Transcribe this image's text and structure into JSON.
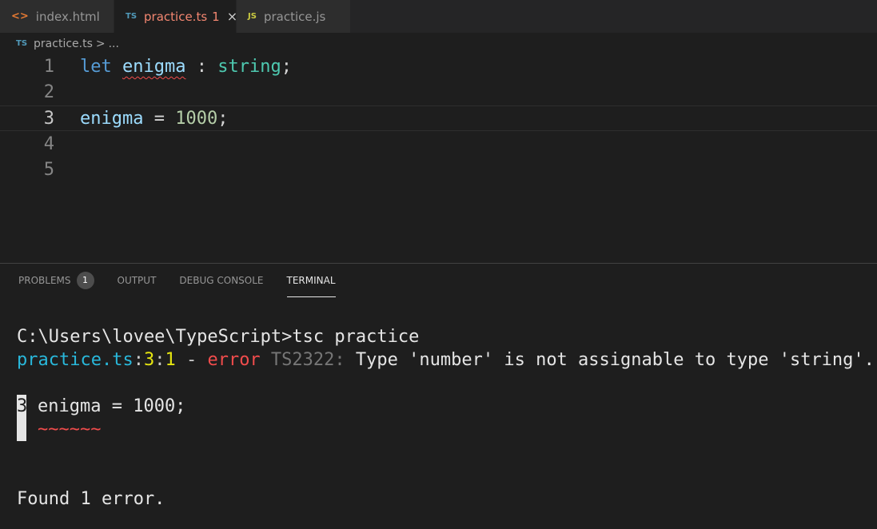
{
  "tabs": [
    {
      "icon": "<>",
      "label": "index.html"
    },
    {
      "icon": "TS",
      "label": "practice.ts",
      "badge": "1",
      "close": "×"
    },
    {
      "icon": "JS",
      "label": "practice.js"
    }
  ],
  "breadcrumb": {
    "icon": "TS",
    "file": "practice.ts",
    "separator": ">",
    "more": "..."
  },
  "editor": {
    "lines": [
      {
        "num": "1",
        "kw": "let",
        "var": "enigma",
        "sep": " : ",
        "type": "string",
        "end": ";"
      },
      {
        "num": "2"
      },
      {
        "num": "3",
        "var": "enigma",
        "op": " = ",
        "value": "1000",
        "end": ";"
      },
      {
        "num": "4"
      },
      {
        "num": "5"
      }
    ]
  },
  "panel": {
    "tabs": [
      "PROBLEMS",
      "OUTPUT",
      "DEBUG CONSOLE",
      "TERMINAL"
    ],
    "problems_count": "1",
    "active_tab": "TERMINAL"
  },
  "terminal": {
    "command": "C:\\Users\\lovee\\TypeScript>tsc practice",
    "error_file": "practice.ts",
    "error_colon1": ":",
    "error_line": "3",
    "error_colon2": ":",
    "error_col": "1",
    "error_dash": " - ",
    "error_word": "error",
    "error_code": " TS2322:",
    "error_message": " Type 'number' is not assignable to type 'string'.",
    "snippet_line_num": "3",
    "snippet_code": "enigma = 1000;",
    "snippet_squiggle": "~~~~~~",
    "summary": "Found 1 error."
  }
}
